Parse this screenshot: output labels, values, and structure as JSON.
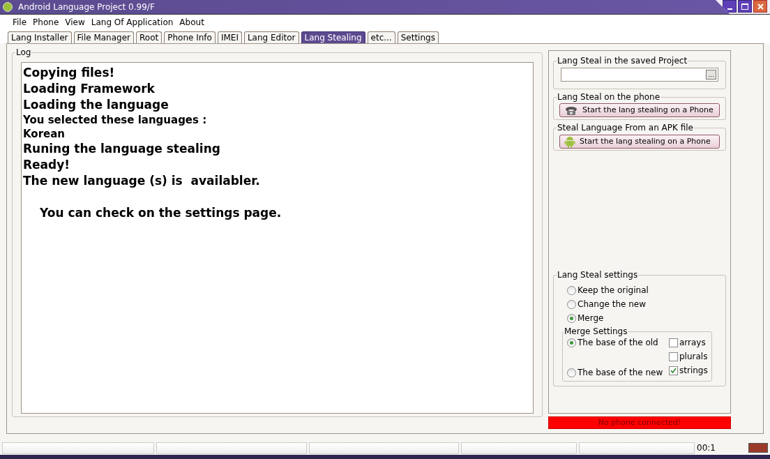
{
  "window": {
    "title": "Android Language Project 0.99/F"
  },
  "menu": [
    "File",
    "Phone",
    "View",
    "Lang Of Application",
    "About"
  ],
  "tabs": [
    {
      "label": "Lang Installer",
      "selected": false
    },
    {
      "label": "File Manager",
      "selected": false
    },
    {
      "label": "Root",
      "selected": false
    },
    {
      "label": "Phone Info",
      "selected": false
    },
    {
      "label": "IMEI",
      "selected": false
    },
    {
      "label": "Lang Editor",
      "selected": false
    },
    {
      "label": "Lang Stealing",
      "selected": true
    },
    {
      "label": "etc...",
      "selected": false
    },
    {
      "label": "Settings",
      "selected": false
    }
  ],
  "log": {
    "title": "Log",
    "lines": [
      {
        "text": "Copying files!",
        "kind": "large"
      },
      {
        "text": "Loading Framework",
        "kind": "large"
      },
      {
        "text": "Loading the language",
        "kind": "large"
      },
      {
        "text": "You selected these languages :",
        "kind": "small"
      },
      {
        "text": "Korean",
        "kind": "small"
      },
      {
        "text": "Runing the language stealing",
        "kind": "large"
      },
      {
        "text": "Ready!",
        "kind": "large"
      },
      {
        "text": "The new language (s) is  availabler.",
        "kind": "large"
      },
      {
        "text": "You can check on the settings page.",
        "kind": "indented"
      }
    ]
  },
  "saved_project": {
    "title": "Lang Steal in the saved Project",
    "browse": "..."
  },
  "phone": {
    "title": "Lang Steal on the phone",
    "button": "Start the lang stealing on a Phone"
  },
  "apk": {
    "title": "Steal Language From an APK file",
    "button": "Start the lang stealing on a Phone"
  },
  "settings": {
    "title": "Lang Steal settings",
    "options": [
      {
        "label": "Keep the original",
        "selected": false
      },
      {
        "label": "Change the new",
        "selected": false
      },
      {
        "label": "Merge",
        "selected": true
      }
    ],
    "merge": {
      "title": "Merge Settings",
      "bases": [
        {
          "label": "The base of the old",
          "selected": true
        },
        {
          "label": "The base of the new",
          "selected": false
        }
      ],
      "types": [
        {
          "label": "arrays",
          "checked": false
        },
        {
          "label": "plurals",
          "checked": false
        },
        {
          "label": "strings",
          "checked": true
        }
      ]
    }
  },
  "status": {
    "message": "No phone connected!",
    "time": "00:1"
  }
}
